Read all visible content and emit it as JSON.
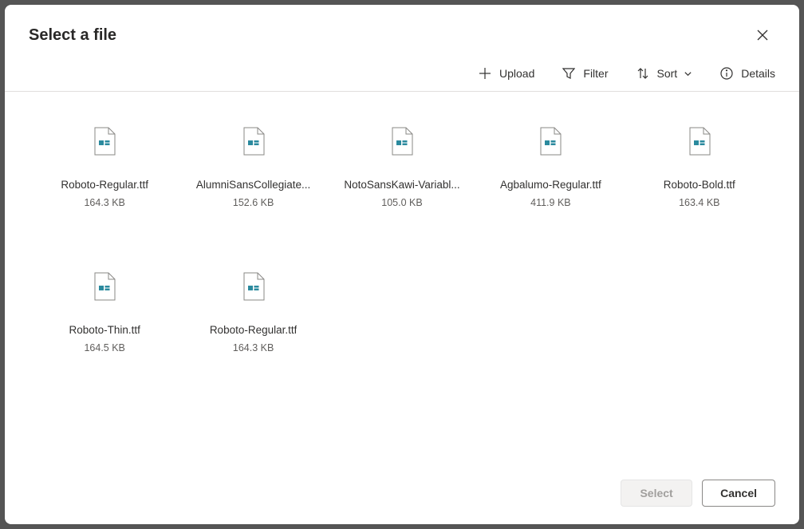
{
  "modal": {
    "title": "Select a file"
  },
  "toolbar": {
    "upload": "Upload",
    "filter": "Filter",
    "sort": "Sort",
    "details": "Details"
  },
  "files": [
    {
      "name": "Roboto-Regular.ttf",
      "size": "164.3 KB"
    },
    {
      "name": "AlumniSansCollegiate...",
      "size": "152.6 KB"
    },
    {
      "name": "NotoSansKawi-Variabl...",
      "size": "105.0 KB"
    },
    {
      "name": "Agbalumo-Regular.ttf",
      "size": "411.9 KB"
    },
    {
      "name": "Roboto-Bold.ttf",
      "size": "163.4 KB"
    },
    {
      "name": "Roboto-Thin.ttf",
      "size": "164.5 KB"
    },
    {
      "name": "Roboto-Regular.ttf",
      "size": "164.3 KB"
    }
  ],
  "footer": {
    "select": "Select",
    "cancel": "Cancel"
  }
}
